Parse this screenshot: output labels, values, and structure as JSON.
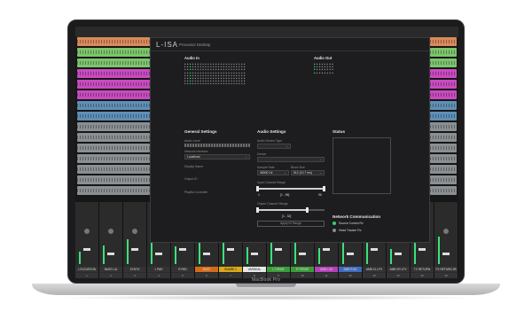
{
  "device": {
    "brand_label": "MacBook Pro"
  },
  "window": {
    "logo": "L-ISA",
    "title": "Processor Desktop"
  },
  "audio_in": {
    "label": "Audio In"
  },
  "audio_out": {
    "label": "Audio Out"
  },
  "general_settings": {
    "heading": "General Settings",
    "rows": [
      {
        "label": "Audio Level",
        "value": ""
      },
      {
        "label": "Network Interface",
        "value": "Localhost"
      },
      {
        "label": "Display Name",
        "value": ""
      },
      {
        "label": "Output ID",
        "value": ""
      },
      {
        "label": "Playlist Controller",
        "value": ""
      }
    ]
  },
  "audio_settings": {
    "heading": "Audio Settings",
    "audio_device_type_label": "Audio Device Type",
    "device_label": "Device",
    "sample_rate_label": "Sample Rate",
    "sample_rate_value": "48000 Hz",
    "block_size_label": "Block Size",
    "block_size_value": "512 (10.7 ms)",
    "input_range_label": "Input Channel Range",
    "input_range_value": "[1 , 96]",
    "input_range_min": "1",
    "input_range_max": "96",
    "output_range_label": "Output Channel Range",
    "output_range_value": "[1 , 32]",
    "apply_button": "Apply IO Range"
  },
  "status": {
    "heading": "Status"
  },
  "network": {
    "heading": "Network Communication",
    "items": [
      {
        "label": "Source Control Rx",
        "color": "#3fcf6a"
      },
      {
        "label": "Head Tracker Rx",
        "color": "#8a8a8a"
      }
    ]
  },
  "mixer": {
    "channels": [
      {
        "name": "L ELEVATION",
        "num": "1",
        "color": "#333333"
      },
      {
        "name": "BASS L/A",
        "num": "2",
        "color": "#333333"
      },
      {
        "name": "SYNTH",
        "num": "3",
        "color": "#333333"
      },
      {
        "name": "L PAD",
        "num": "4",
        "color": "#333333"
      },
      {
        "name": "R PAD",
        "num": "5",
        "color": "#333333"
      },
      {
        "name": "BASS",
        "num": "6",
        "color": "#d46b1a"
      },
      {
        "name": "SNARE 1",
        "num": "7",
        "color": "#d9a91a"
      },
      {
        "name": "VARDEAL",
        "num": "8",
        "color": "#e8e8e8"
      },
      {
        "name": "L THEME",
        "num": "9",
        "color": "#3a9c3a"
      },
      {
        "name": "R THEME",
        "num": "10",
        "color": "#3a9c3a"
      },
      {
        "name": "AMB L AS",
        "num": "11",
        "color": "#b63fb6"
      },
      {
        "name": "AMB R AS",
        "num": "12",
        "color": "#3f6bbf"
      },
      {
        "name": "AMB XL LFX",
        "num": "13",
        "color": "#333333"
      },
      {
        "name": "AMB XR LFX",
        "num": "14",
        "color": "#333333"
      },
      {
        "name": "TV RETURN",
        "num": "15",
        "color": "#333333"
      },
      {
        "name": "FX RETURN 2B",
        "num": "16",
        "color": "#333333"
      }
    ]
  },
  "colors": {
    "track_orange": "#d98a5b",
    "track_green": "#7cc46d",
    "track_magenta": "#c84bc0",
    "track_blue": "#5f8fb5",
    "track_gray": "#8a8f92",
    "meter_green": "#3de07a"
  }
}
